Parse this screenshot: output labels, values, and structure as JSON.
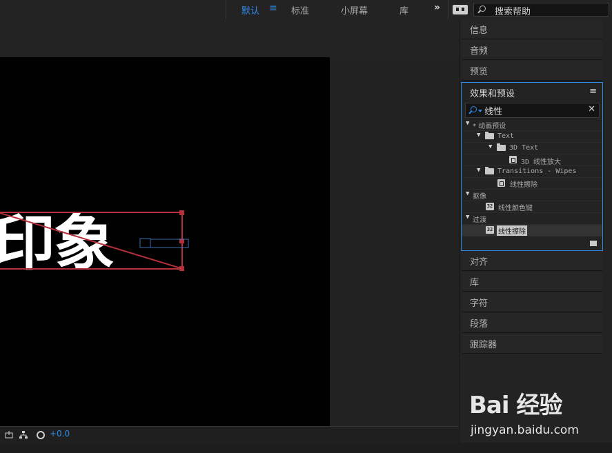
{
  "workspaces": [
    {
      "label": "默认",
      "active": true
    },
    {
      "label": "标准",
      "active": false
    },
    {
      "label": "小屏幕",
      "active": false
    },
    {
      "label": "库",
      "active": false
    }
  ],
  "help_search": {
    "placeholder": "搜索帮助"
  },
  "viewer": {
    "comp_text": "印象",
    "exposure_value": "+0.0"
  },
  "panels_top": [
    "信息",
    "音频",
    "预览"
  ],
  "effects_panel": {
    "title": "效果和预设",
    "search_value": "线性",
    "tree": [
      {
        "label": "* 动画预设",
        "level": 0,
        "type": "category"
      },
      {
        "label": "Text",
        "level": 1,
        "type": "folder"
      },
      {
        "label": "3D Text",
        "level": 2,
        "type": "folder"
      },
      {
        "label": "3D 线性放大",
        "level": 3,
        "type": "preset"
      },
      {
        "label": "Transitions - Wipes",
        "level": 1,
        "type": "folder"
      },
      {
        "label": "线性擦除",
        "level": 2,
        "type": "preset"
      },
      {
        "label": "抠像",
        "level": 0,
        "type": "category"
      },
      {
        "label": "线性颜色键",
        "level": 1,
        "type": "effect"
      },
      {
        "label": "过渡",
        "level": 0,
        "type": "category"
      },
      {
        "label": "线性擦除",
        "level": 1,
        "type": "effect",
        "selected": true
      }
    ]
  },
  "panels_bottom": [
    "对齐",
    "库",
    "字符",
    "段落",
    "跟踪器"
  ],
  "watermark": {
    "brand": "Bai 经验",
    "url": "jingyan.baidu.com"
  },
  "colors": {
    "accent": "#2d8ceb",
    "selection_box": "#b5303a"
  }
}
